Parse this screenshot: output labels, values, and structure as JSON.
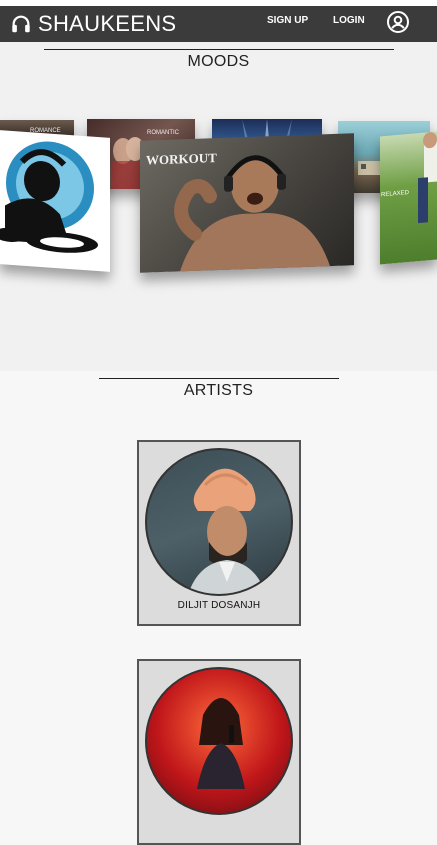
{
  "brand": {
    "name": "SHAUKEENS",
    "icon": "headphones-icon"
  },
  "nav": {
    "signup": "SIGN UP",
    "login": "LOGIN",
    "account_icon": "account-circle-icon"
  },
  "moods": {
    "title": "MOODS",
    "cards": [
      {
        "label": "ROMANCE"
      },
      {
        "label": "ROMANTIC"
      },
      {
        "label": ""
      },
      {
        "label": ""
      },
      {
        "label": ""
      },
      {
        "label": "WORKOUT"
      },
      {
        "label": "RELAXED"
      }
    ]
  },
  "artists": {
    "title": "ARTISTS",
    "items": [
      {
        "name": "DILJIT DOSANJH"
      },
      {
        "name": ""
      }
    ]
  },
  "colors": {
    "navbar": "#3b3b3b",
    "moods_bg": "#f1f1f1",
    "page_bg": "#f7f7f7",
    "card_bg": "#dcdcdc"
  }
}
